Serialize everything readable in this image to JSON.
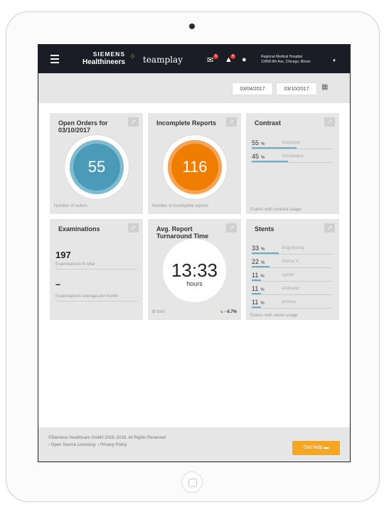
{
  "header": {
    "brand_line1": "SIEMENS",
    "brand_line2": "Healthineers",
    "app_name": "teamplay",
    "badges": {
      "messages": "5",
      "alerts": "4"
    },
    "hospital_name": "Regional Medical Hospital",
    "hospital_address": "13958 8th Ave, Chicago, Illinois"
  },
  "filter": {
    "start_date": "03/04/2017",
    "end_date": "03/10/2017"
  },
  "tiles": {
    "open_orders": {
      "title": "Open Orders for 03/10/2017",
      "value": "55",
      "footer": "Number of orders",
      "color": "#4a9ab8"
    },
    "incomplete_reports": {
      "title": "Incomplete Reports",
      "value": "116",
      "footer": "Number of incomplete reports",
      "color": "#ef7d00"
    },
    "contrast": {
      "title": "Contrast",
      "items": [
        {
          "value": "55",
          "unit": "%",
          "label": "Visipaque",
          "fraction": 0.55
        },
        {
          "value": "45",
          "unit": "%",
          "label": "Omnipaque",
          "fraction": 0.45
        }
      ],
      "footer": "Exams with contrast usage"
    },
    "examinations": {
      "title": "Examinations",
      "total": "197",
      "total_label": "Examinations in total",
      "average": "–",
      "average_label": "Examinations average per month"
    },
    "turnaround": {
      "title": "Avg. Report Turnaround Time",
      "time": "13:33",
      "unit": "hours",
      "footer": "Ø time",
      "trend": "- 6.7%"
    },
    "stents": {
      "title": "Stents",
      "items": [
        {
          "value": "33",
          "unit": "%",
          "label": "drug eluting",
          "fraction": 0.33
        },
        {
          "value": "22",
          "unit": "%",
          "label": "Xience V",
          "fraction": 0.22
        },
        {
          "value": "11",
          "unit": "%",
          "label": "cypher",
          "fraction": 0.11
        },
        {
          "value": "11",
          "unit": "%",
          "label": "endeavor",
          "fraction": 0.11
        },
        {
          "value": "11",
          "unit": "%",
          "label": "promus",
          "fraction": 0.11
        }
      ],
      "footer": "Exams with stents usage"
    }
  },
  "footer": {
    "copyright": "©Siemens Healthcare GmbH 2015–2016, All Rights Reserved",
    "link1": "Open Source Licensing",
    "link2": "Privacy Policy",
    "help_label": "Get help"
  }
}
